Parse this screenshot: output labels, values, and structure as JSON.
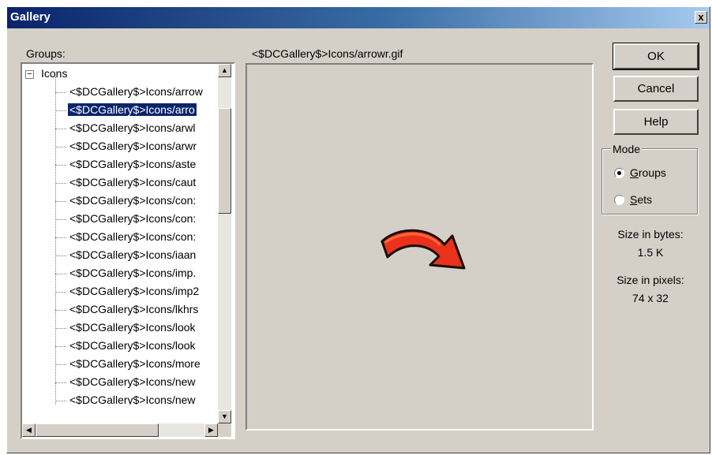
{
  "window": {
    "title": "Gallery",
    "close_label": "x"
  },
  "groups": {
    "label": "Groups:",
    "root": {
      "expander": "−",
      "label": "Icons"
    },
    "items": [
      "<$DCGallery$>Icons/arrow",
      "<$DCGallery$>Icons/arro",
      "<$DCGallery$>Icons/arwl",
      "<$DCGallery$>Icons/arwr",
      "<$DCGallery$>Icons/aste",
      "<$DCGallery$>Icons/caut",
      "<$DCGallery$>Icons/con:",
      "<$DCGallery$>Icons/con:",
      "<$DCGallery$>Icons/con:",
      "<$DCGallery$>Icons/iaan",
      "<$DCGallery$>Icons/imp.",
      "<$DCGallery$>Icons/imp2",
      "<$DCGallery$>Icons/lkhrs",
      "<$DCGallery$>Icons/look",
      "<$DCGallery$>Icons/look",
      "<$DCGallery$>Icons/more",
      "<$DCGallery$>Icons/new",
      "<$DCGallery$>Icons/new"
    ],
    "selected_index": 1,
    "scroll": {
      "up": "▲",
      "down": "▼",
      "left": "◀",
      "right": "▶"
    }
  },
  "preview": {
    "path": "<$DCGallery$>Icons/arrowr.gif",
    "icon": "curved-arrow-right-icon",
    "colors": {
      "fill": "#e8321c",
      "highlight": "#ff6a3a",
      "outline": "#1a0b06"
    }
  },
  "buttons": {
    "ok": "OK",
    "cancel": "Cancel",
    "help": "Help"
  },
  "mode": {
    "legend": "Mode",
    "options": [
      {
        "label": "Groups",
        "selected": true
      },
      {
        "label": "Sets",
        "selected": false
      }
    ]
  },
  "info": {
    "size_bytes_label": "Size in bytes:",
    "size_bytes_value": "1.5 K",
    "size_pixels_label": "Size in pixels:",
    "size_pixels_value": "74 x 32"
  },
  "colors": {
    "face": "#d4d0c8",
    "selection": "#0a246a",
    "title_start": "#0a246a",
    "title_end": "#a6caf0"
  }
}
